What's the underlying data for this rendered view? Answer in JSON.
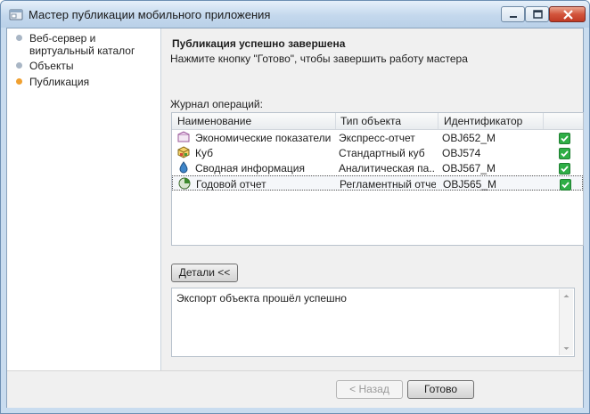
{
  "window": {
    "title": "Мастер публикации мобильного приложения"
  },
  "nav": {
    "items": [
      {
        "label": "Веб-сервер и виртуальный каталог",
        "state": "done"
      },
      {
        "label": "Объекты",
        "state": "done"
      },
      {
        "label": "Публикация",
        "state": "active"
      }
    ]
  },
  "header": {
    "title": "Публикация успешно завершена",
    "subtitle": "Нажмите кнопку \"Готово\", чтобы завершить работу мастера"
  },
  "log": {
    "label": "Журнал операций:",
    "columns": [
      "Наименование",
      "Тип объекта",
      "Идентификатор"
    ],
    "rows": [
      {
        "name": "Экономические показатели",
        "type": "Экспресс-отчет",
        "id": "OBJ652_M",
        "icon": "express-report-icon",
        "ok": true
      },
      {
        "name": "Куб",
        "type": "Стандартный куб",
        "id": "OBJ574",
        "icon": "cube-icon",
        "ok": true
      },
      {
        "name": "Сводная информация",
        "type": "Аналитическая па...",
        "id": "OBJ567_M",
        "icon": "analytic-panel-icon",
        "ok": true
      },
      {
        "name": "Годовой отчет",
        "type": "Регламентный отчет",
        "id": "OBJ565_M",
        "icon": "regular-report-icon",
        "ok": true
      }
    ]
  },
  "details": {
    "button_label": "Детали <<",
    "text": "Экспорт объекта прошёл успешно"
  },
  "footer": {
    "back_label": "< Назад",
    "finish_label": "Готово"
  },
  "colors": {
    "accent_active": "#f0a030",
    "check_green": "#2fae46",
    "close_button": "#c13a24"
  }
}
